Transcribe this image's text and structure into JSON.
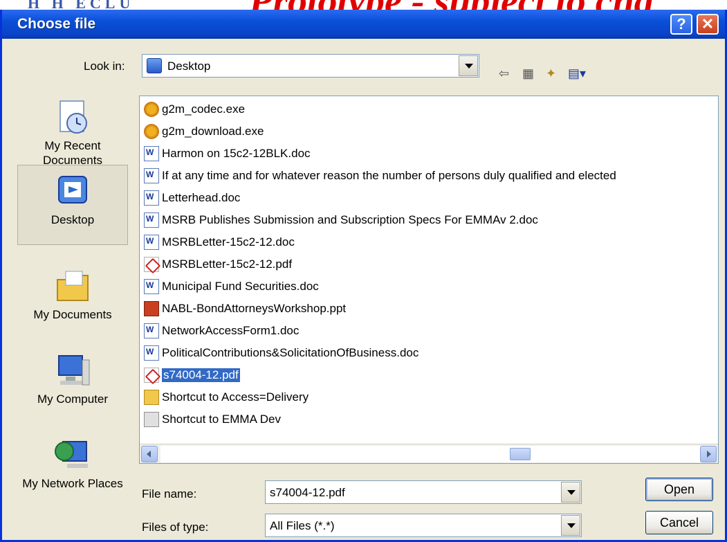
{
  "dialog": {
    "title": "Choose file"
  },
  "look_in": {
    "label": "Look in:",
    "value": "Desktop"
  },
  "places": [
    {
      "label": "My Recent Documents",
      "icon": "recent-documents-icon"
    },
    {
      "label": "Desktop",
      "icon": "desktop-icon",
      "selected": true
    },
    {
      "label": "My Documents",
      "icon": "my-documents-icon"
    },
    {
      "label": "My Computer",
      "icon": "my-computer-icon"
    },
    {
      "label": "My Network Places",
      "icon": "network-places-icon"
    }
  ],
  "files": [
    {
      "name": "g2m_codec.exe",
      "type": "exe"
    },
    {
      "name": "g2m_download.exe",
      "type": "exe"
    },
    {
      "name": "Harmon on 15c2-12BLK.doc",
      "type": "doc"
    },
    {
      "name": "If at any time and for whatever reason the number of persons duly qualified and elected",
      "type": "doc"
    },
    {
      "name": "Letterhead.doc",
      "type": "doc"
    },
    {
      "name": "MSRB Publishes Submission and Subscription Specs For EMMAv 2.doc",
      "type": "doc"
    },
    {
      "name": "MSRBLetter-15c2-12.doc",
      "type": "doc"
    },
    {
      "name": "MSRBLetter-15c2-12.pdf",
      "type": "pdf"
    },
    {
      "name": "Municipal Fund Securities.doc",
      "type": "doc"
    },
    {
      "name": "NABL-BondAttorneysWorkshop.ppt",
      "type": "ppt"
    },
    {
      "name": "NetworkAccessForm1.doc",
      "type": "doc"
    },
    {
      "name": "PoliticalContributions&SolicitationOfBusiness.doc",
      "type": "doc"
    },
    {
      "name": "s74004-12.pdf",
      "type": "pdf",
      "selected": true
    },
    {
      "name": "Shortcut to Access=Delivery",
      "type": "folder"
    },
    {
      "name": "Shortcut to EMMA Dev",
      "type": "lnk"
    }
  ],
  "file_name": {
    "label": "File name:",
    "value": "s74004-12.pdf"
  },
  "file_type": {
    "label": "Files of type:",
    "value": "All Files (*.*)"
  },
  "buttons": {
    "open": "Open",
    "cancel": "Cancel"
  },
  "background": {
    "logo_text": "H H ECLU",
    "banner_text": "Prototype - subject to cha"
  }
}
